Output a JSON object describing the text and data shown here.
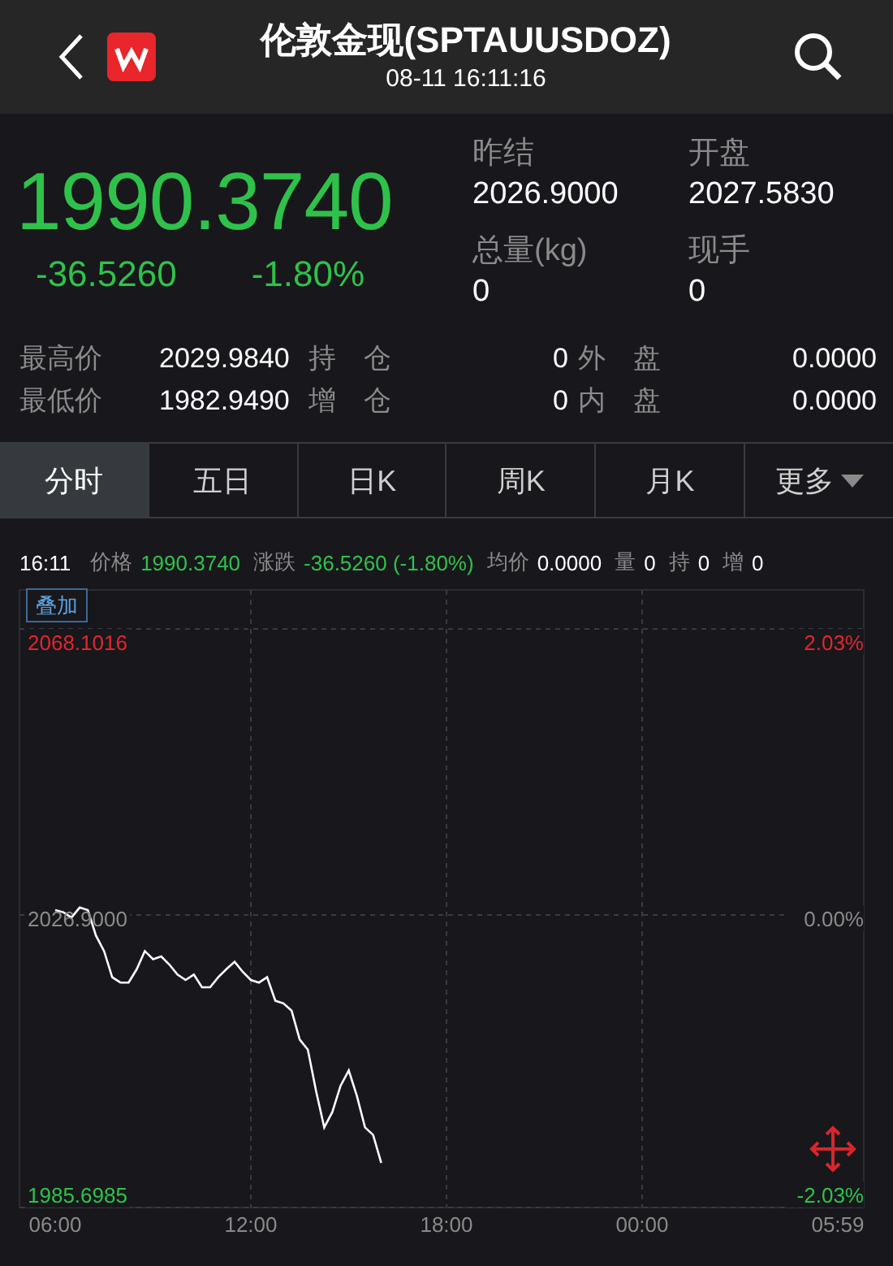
{
  "header": {
    "title": "伦敦金现(SPTAUUSDOZ)",
    "time": "08-11 16:11:16"
  },
  "quote": {
    "price": "1990.3740",
    "change": "-36.5260",
    "change_pct": "-1.80%",
    "color": "#2fc24a"
  },
  "stats": [
    {
      "label": "昨结",
      "value": "2026.9000"
    },
    {
      "label": "开盘",
      "value": "2027.5830"
    },
    {
      "label": "总量(kg)",
      "value": "0"
    },
    {
      "label": "现手",
      "value": "0"
    }
  ],
  "details": [
    {
      "label": "最高价",
      "value": "2029.9840",
      "label2": "持　仓",
      "value2": "0",
      "label3": "外　盘",
      "value3": "0.0000"
    },
    {
      "label": "最低价",
      "value": "1982.9490",
      "label2": "增　仓",
      "value2": "0",
      "label3": "内　盘",
      "value3": "0.0000"
    }
  ],
  "tabs": [
    {
      "label": "分时",
      "selected": true,
      "kind": "tab"
    },
    {
      "label": "五日",
      "selected": false,
      "kind": "tab"
    },
    {
      "label": "日K",
      "selected": false,
      "kind": "tab"
    },
    {
      "label": "周K",
      "selected": false,
      "kind": "tab"
    },
    {
      "label": "月K",
      "selected": false,
      "kind": "tab"
    },
    {
      "label": "更多",
      "selected": false,
      "kind": "dropdown"
    }
  ],
  "info_bar": {
    "time": "16:11",
    "items": [
      {
        "label": "价格",
        "value": "1990.3740",
        "color": "#2fc24a"
      },
      {
        "label": "涨跌",
        "value": "-36.5260 (-1.80%)",
        "color": "#2fc24a"
      },
      {
        "label": "均价",
        "value": "0.0000",
        "color": "#ffffff"
      },
      {
        "label": "量",
        "value": "0",
        "color": "#ffffff"
      },
      {
        "label": "持",
        "value": "0",
        "color": "#ffffff"
      },
      {
        "label": "增",
        "value": "0",
        "color": "#ffffff"
      }
    ]
  },
  "chart": {
    "overlay_button": "叠加",
    "right_labels": [
      {
        "text": "2.03%",
        "color": "#e0262b"
      },
      {
        "text": "0.00%",
        "color": "#8a8a8a"
      },
      {
        "text": "-2.03%",
        "color": "#2fc24a"
      }
    ],
    "chart_data": {
      "type": "line",
      "grid": true,
      "ylim": [
        1985.6985,
        2068.1016
      ],
      "yticks": [
        {
          "value": 2068.1016,
          "label": "2068.1016"
        },
        {
          "value": 2026.9,
          "label": "2026.9000"
        },
        {
          "value": 1985.6985,
          "label": "1985.6985"
        }
      ],
      "categories": [
        "06:00",
        null,
        null,
        null,
        null,
        null,
        null,
        null,
        null,
        null,
        null,
        null,
        null,
        null,
        null,
        null,
        null,
        null,
        null,
        null,
        null,
        null,
        null,
        null,
        "12:00",
        null,
        null,
        null,
        null,
        null,
        null,
        null,
        null,
        null,
        null,
        null,
        null,
        null,
        null,
        null,
        null,
        null,
        null,
        null,
        null,
        null,
        null,
        null,
        "18:00",
        null,
        null,
        null,
        null,
        null,
        null,
        null,
        null,
        null,
        null,
        null,
        null,
        null,
        null,
        null,
        null,
        null,
        null,
        null,
        null,
        null,
        null,
        null,
        "00:00",
        null,
        null,
        null,
        null,
        null,
        null,
        null,
        null,
        null,
        null,
        null,
        null,
        null,
        null,
        null,
        null,
        null,
        null,
        null,
        null,
        null,
        null,
        null,
        "05:59"
      ],
      "series": [
        {
          "color": "#ffffff",
          "values": [
            2028.1,
            2027.8,
            2027.0,
            2028.5,
            2028.1,
            2024.3,
            2022.0,
            2018.1,
            2017.3,
            2017.3,
            2019.3,
            2022.0,
            2020.8,
            2021.2,
            2020.0,
            2018.5,
            2017.7,
            2018.5,
            2016.6,
            2016.6,
            2018.1,
            2019.3,
            2020.4,
            2018.9,
            2017.7,
            2017.3,
            2018.1,
            2014.6,
            2014.2,
            2013.1,
            2008.8,
            2007.3,
            2001.1,
            1995.7,
            1998.0,
            2001.9,
            2004.2,
            2000.4,
            1995.7,
            1994.6,
            1990.4,
            null,
            null,
            null,
            null,
            null,
            null,
            null,
            null,
            null,
            null,
            null,
            null,
            null,
            null,
            null,
            null,
            null,
            null,
            null,
            null,
            null,
            null,
            null,
            null,
            null,
            null,
            null,
            null,
            null,
            null,
            null,
            null,
            null,
            null,
            null,
            null,
            null,
            null,
            null,
            null,
            null,
            null,
            null,
            null,
            null,
            null,
            null,
            null,
            null,
            null,
            null,
            null,
            null,
            null,
            null,
            null
          ]
        }
      ]
    }
  }
}
